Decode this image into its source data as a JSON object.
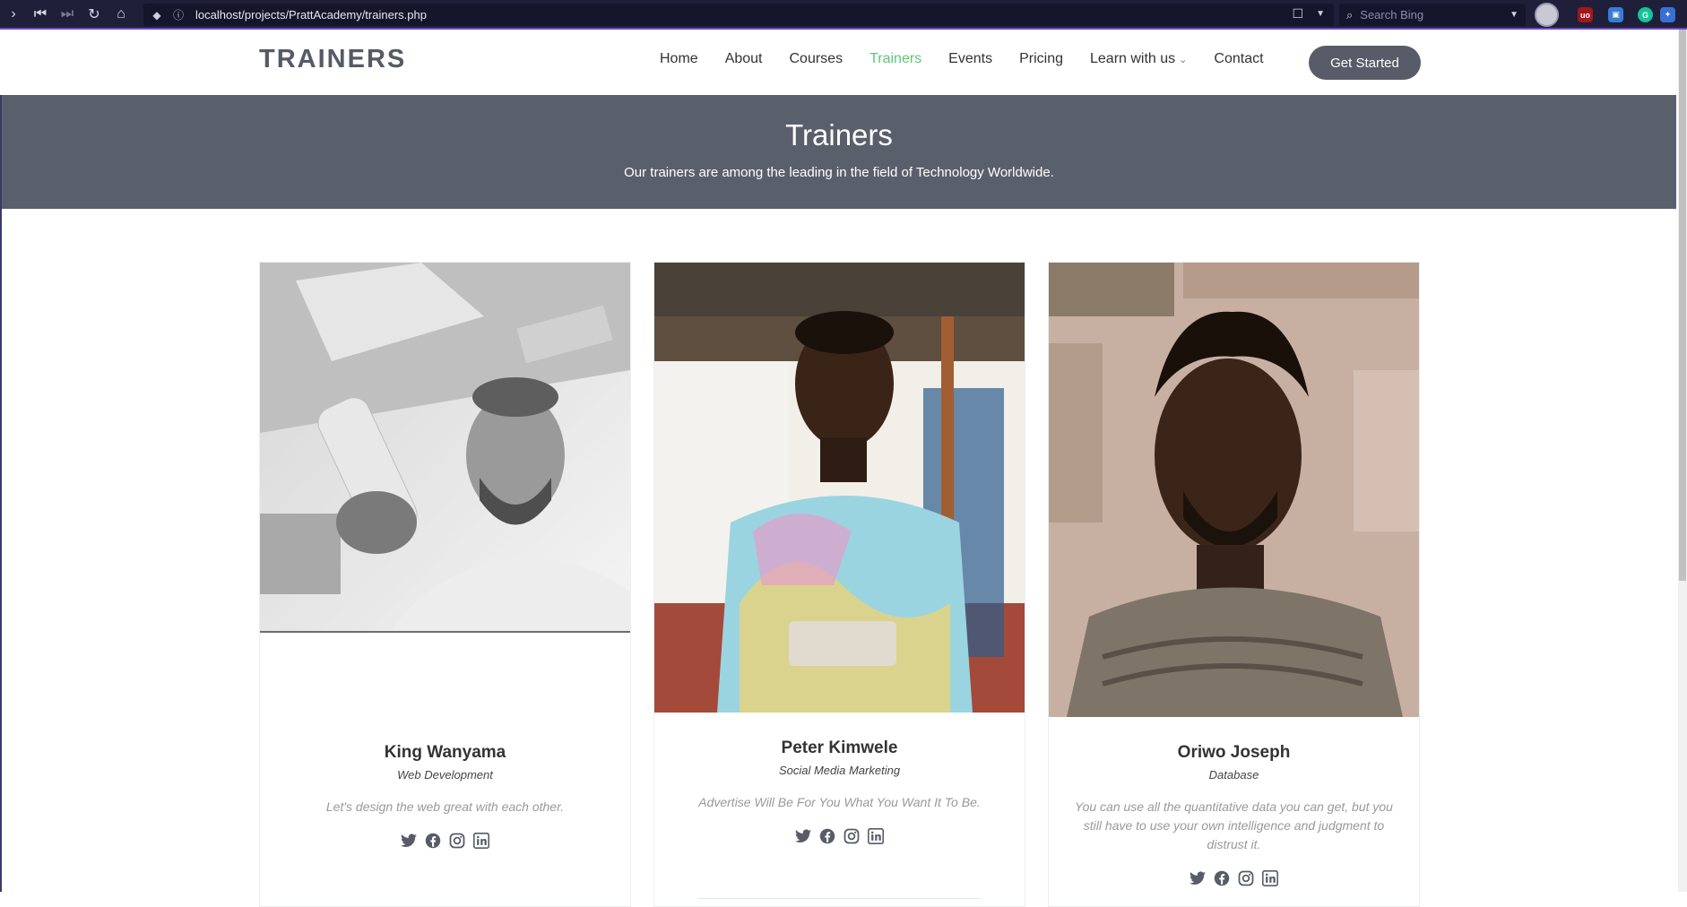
{
  "browser": {
    "url": "localhost/projects/PrattAcademy/trainers.php",
    "search_placeholder": "Search Bing"
  },
  "header": {
    "logo": "TRAINERS",
    "nav": [
      {
        "label": "Home"
      },
      {
        "label": "About"
      },
      {
        "label": "Courses"
      },
      {
        "label": "Trainers",
        "active": true
      },
      {
        "label": "Events"
      },
      {
        "label": "Pricing"
      },
      {
        "label": "Learn with us",
        "has_dropdown": true
      },
      {
        "label": "Contact"
      }
    ],
    "cta": "Get Started",
    "active_color": "#5fc37b"
  },
  "hero": {
    "title": "Trainers",
    "subtitle": "Our trainers are among the leading in the field of Technology Worldwide."
  },
  "trainers": [
    {
      "name": "King Wanyama",
      "role": "Web Development",
      "quote": "Let's design the web great with each other.",
      "socials": [
        "twitter-icon",
        "facebook-icon",
        "instagram-icon",
        "linkedin-icon"
      ]
    },
    {
      "name": "Peter Kimwele",
      "role": "Social Media Marketing",
      "quote": "Advertise Will Be For You What You Want It To Be.",
      "socials": [
        "twitter-icon",
        "facebook-icon",
        "instagram-icon",
        "linkedin-icon"
      ]
    },
    {
      "name": "Oriwo Joseph",
      "role": "Database",
      "quote": "You can use all the quantitative data you can get, but you still have to use your own intelligence and judgment to distrust it.",
      "socials": [
        "twitter-icon",
        "facebook-icon",
        "instagram-icon",
        "linkedin-icon"
      ]
    }
  ],
  "colors": {
    "hero_bg": "#5a5f6c",
    "button_bg": "#575c68",
    "social_icon": "#575c68"
  }
}
